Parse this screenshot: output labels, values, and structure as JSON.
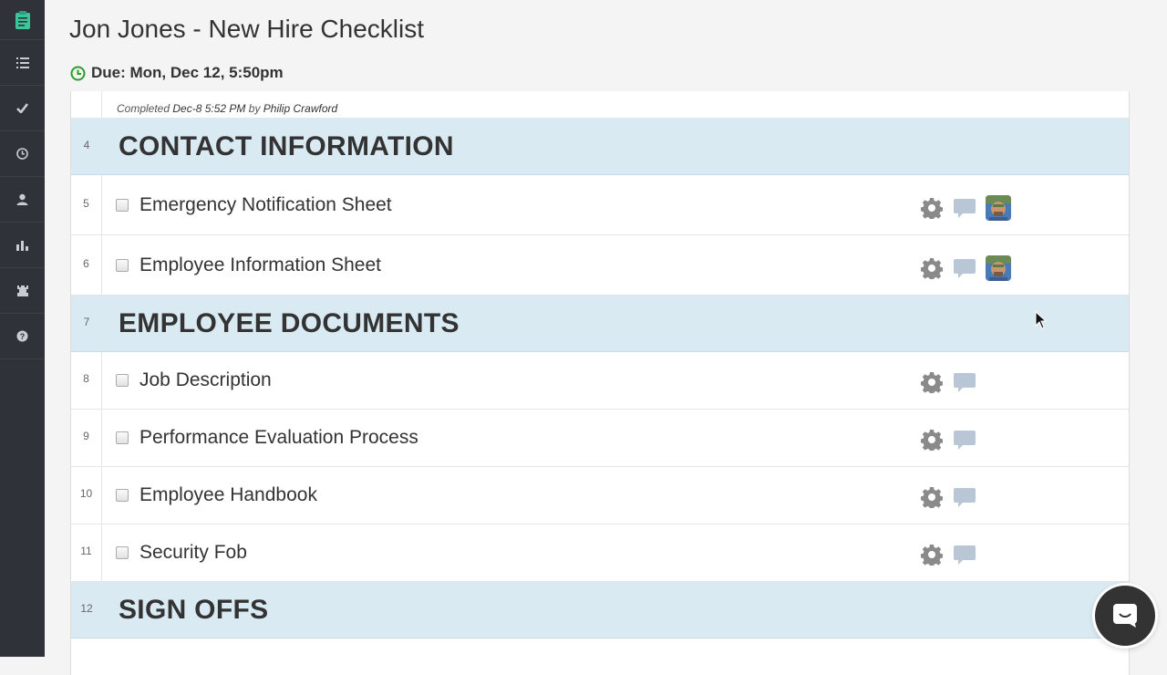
{
  "page": {
    "title": "Jon Jones - New Hire Checklist",
    "due": "Due: Mon, Dec 12, 5:50pm"
  },
  "sidebar": {
    "items": [
      {
        "icon": "checklist-logo-icon"
      },
      {
        "icon": "list-icon"
      },
      {
        "icon": "checkmark-icon"
      },
      {
        "icon": "clock-icon"
      },
      {
        "icon": "user-icon"
      },
      {
        "icon": "bar-chart-icon"
      },
      {
        "icon": "rook-icon"
      },
      {
        "icon": "help-icon"
      }
    ]
  },
  "completed": {
    "prefix": "Completed",
    "date": "Dec-8 5:52 PM",
    "by": "by",
    "user": "Philip Crawford"
  },
  "rows": [
    {
      "num": "4",
      "type": "heading",
      "label": "CONTACT INFORMATION"
    },
    {
      "num": "5",
      "type": "task",
      "label": "Emergency Notification Sheet",
      "assigned": true
    },
    {
      "num": "6",
      "type": "task",
      "label": "Employee Information Sheet",
      "assigned": true
    },
    {
      "num": "7",
      "type": "heading",
      "label": "EMPLOYEE DOCUMENTS"
    },
    {
      "num": "8",
      "type": "task",
      "label": "Job Description",
      "assigned": false
    },
    {
      "num": "9",
      "type": "task",
      "label": "Performance Evaluation Process",
      "assigned": false
    },
    {
      "num": "10",
      "type": "task",
      "label": "Employee Handbook",
      "assigned": false
    },
    {
      "num": "11",
      "type": "task",
      "label": "Security Fob",
      "assigned": false
    },
    {
      "num": "12",
      "type": "heading",
      "label": "SIGN OFFS"
    }
  ],
  "colors": {
    "sidebar_bg": "#2f3339",
    "heading_bg": "#d9eaf3",
    "due_icon": "#2a9d2a",
    "logo": "#3cc49a",
    "comment_icon": "#b8c6d6"
  }
}
